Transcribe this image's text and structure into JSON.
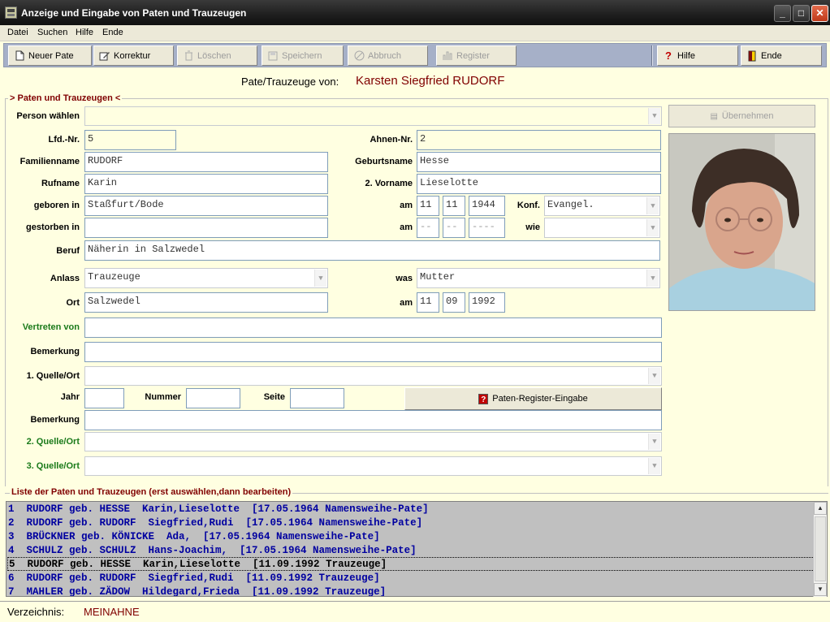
{
  "window": {
    "title": "Anzeige und Eingabe von Paten und Trauzeugen"
  },
  "menu": [
    "Datei",
    "Suchen",
    "Hilfe",
    "Ende"
  ],
  "toolbar": {
    "neuer_pate": "Neuer Pate",
    "korrektur": "Korrektur",
    "loeschen": "Löschen",
    "speichern": "Speichern",
    "abbruch": "Abbruch",
    "register": "Register",
    "hilfe": "Hilfe",
    "ende": "Ende"
  },
  "header": {
    "label": "Pate/Trauzeuge von:",
    "person": "Karsten Siegfried RUDORF"
  },
  "group_title": "> Paten und Trauzeugen <",
  "form": {
    "person_waehlen_label": "Person wählen",
    "person_waehlen_value": "",
    "uebernehmen": "Übernehmen",
    "lfd_nr_label": "Lfd.-Nr.",
    "lfd_nr": "5",
    "ahnen_nr_label": "Ahnen-Nr.",
    "ahnen_nr": "2",
    "familienname_label": "Familienname",
    "familienname": "RUDORF",
    "geburtsname_label": "Geburtsname",
    "geburtsname": "Hesse",
    "rufname_label": "Rufname",
    "rufname": "Karin",
    "vorname2_label": "2. Vorname",
    "vorname2": "Lieselotte",
    "geboren_in_label": "geboren in",
    "geboren_in": "Staßfurt/Bode",
    "am_label": "am",
    "geb_tag": "11",
    "geb_monat": "11",
    "geb_jahr": "1944",
    "konf_label": "Konf.",
    "konf": "Evangel.",
    "gestorben_in_label": "gestorben in",
    "gestorben_in": "",
    "gest_tag": "--",
    "gest_monat": "--",
    "gest_jahr": "----",
    "wie_label": "wie",
    "wie": "",
    "beruf_label": "Beruf",
    "beruf": "Näherin in Salzwedel",
    "anlass_label": "Anlass",
    "anlass": "Trauzeuge",
    "was_label": "was",
    "was": "Mutter",
    "ort_label": "Ort",
    "ort": "Salzwedel",
    "ort_tag": "11",
    "ort_monat": "09",
    "ort_jahr": "1992",
    "vertreten_von_label": "Vertreten von",
    "vertreten_von": "",
    "bemerkung_label": "Bemerkung",
    "bemerkung1": "",
    "quelle1_label": "1. Quelle/Ort",
    "quelle1": "",
    "jahr_label": "Jahr",
    "jahr": "",
    "nummer_label": "Nummer",
    "nummer": "",
    "seite_label": "Seite",
    "seite": "",
    "paten_register_btn": "Paten-Register-Eingabe",
    "bemerkung2": "",
    "quelle2_label": "2. Quelle/Ort",
    "quelle2": "",
    "quelle3_label": "3. Quelle/Ort",
    "quelle3": ""
  },
  "list": {
    "title": "Liste der Paten und Trauzeugen (erst auswählen,dann bearbeiten)",
    "rows": [
      "1  RUDORF geb. HESSE  Karin,Lieselotte  [17.05.1964 Namensweihe-Pate]",
      "2  RUDORF geb. RUDORF  Siegfried,Rudi  [17.05.1964 Namensweihe-Pate]",
      "3  BRÜCKNER geb. KÖNICKE  Ada,  [17.05.1964 Namensweihe-Pate]",
      "4  SCHULZ geb. SCHULZ  Hans-Joachim,  [17.05.1964 Namensweihe-Pate]",
      "5  RUDORF geb. HESSE  Karin,Lieselotte  [11.09.1992 Trauzeuge]",
      "6  RUDORF geb. RUDORF  Siegfried,Rudi  [11.09.1992 Trauzeuge]",
      "7  MAHLER geb. ZÄDOW  Hildegard,Frieda  [11.09.1992 Trauzeuge]"
    ],
    "selected_index": 4
  },
  "status": {
    "label": "Verzeichnis:",
    "value": "MEINAHNE"
  },
  "colors": {
    "accent_red": "#800000",
    "toolbar_bg": "#a6b0c8",
    "form_bg": "#ffffe1",
    "list_text": "#0000a0"
  }
}
